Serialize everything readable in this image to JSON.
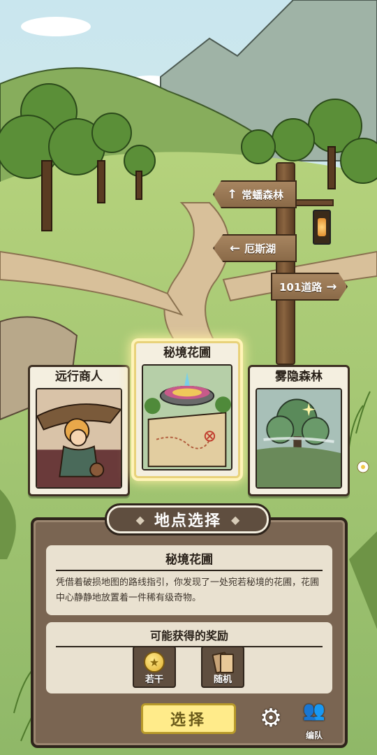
{
  "signs": [
    {
      "label": "常蟠森林",
      "arrow": "↑"
    },
    {
      "label": "厄斯湖",
      "arrow": "←"
    },
    {
      "label": "101道路",
      "arrow": "→"
    }
  ],
  "cards": [
    {
      "name": "远行商人",
      "selected": false
    },
    {
      "name": "秘境花圃",
      "selected": true
    },
    {
      "name": "雾隐森林",
      "selected": false
    }
  ],
  "panel": {
    "header": "地点选择",
    "location_name": "秘境花圃",
    "description": "凭借着破损地图的路线指引，你发现了一处宛若秘境的花圃，花圃中心静静地放置着一件稀有级奇物。",
    "rewards_title": "可能获得的奖励",
    "rewards": [
      {
        "label": "若干",
        "icon": "gold-coin-icon"
      },
      {
        "label": "随机",
        "icon": "cards-icon"
      }
    ],
    "select_label": "选择",
    "team_label": "编队"
  },
  "colors": {
    "panel": "#7a6552",
    "panel_border": "#2e241b",
    "box": "#e9e1d0",
    "select_button": "#ffeb8a",
    "highlight": "#fff4b8"
  }
}
